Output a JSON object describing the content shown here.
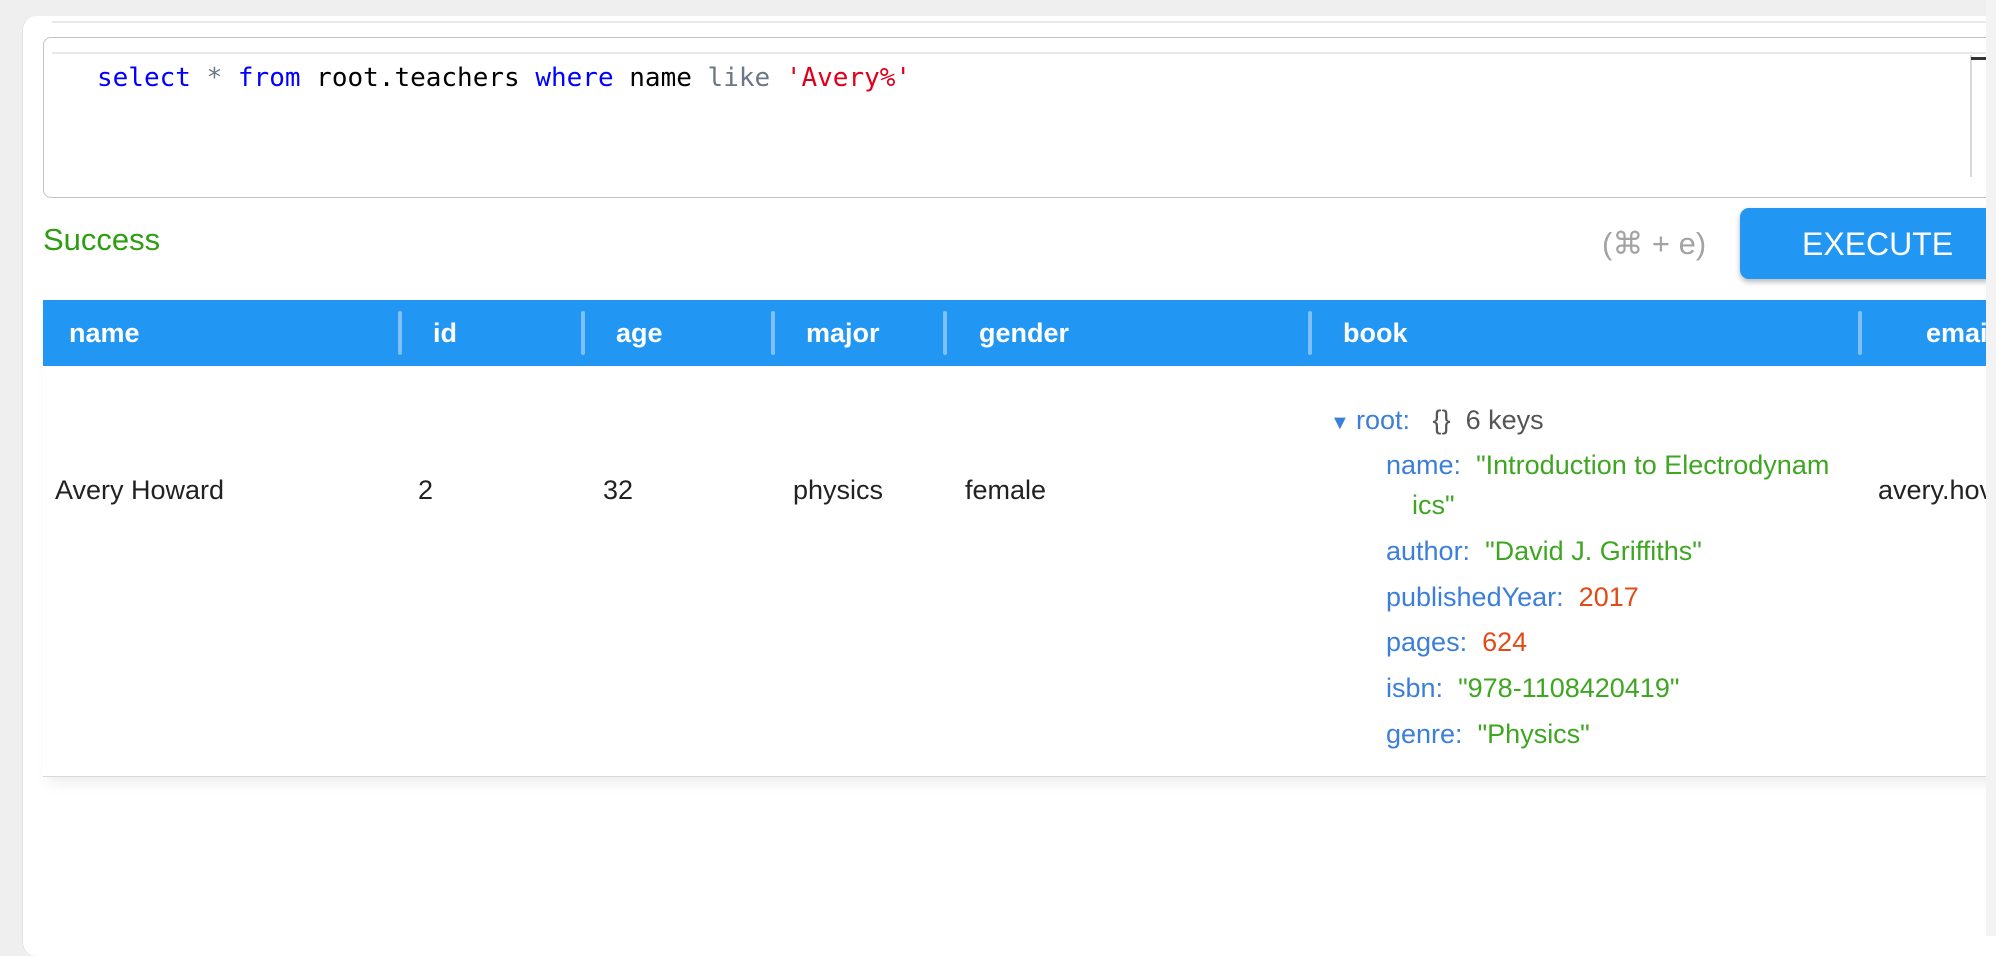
{
  "editor": {
    "query_tokens": {
      "kw_select": "select",
      "star": "*",
      "kw_from": "from",
      "table": "root.teachers",
      "kw_where": "where",
      "field": "name",
      "kw_like": "like",
      "pattern": "'Avery%'"
    }
  },
  "status": {
    "text": "Success",
    "color": "#2e9d12"
  },
  "shortcut": {
    "text": "(⌘ + e)"
  },
  "execute_button": {
    "label": "EXECUTE",
    "color": "#2196f3"
  },
  "table": {
    "header_color": "#2196f3",
    "columns": [
      "name",
      "id",
      "age",
      "major",
      "gender",
      "book",
      "email"
    ],
    "rows": [
      {
        "name": "Avery Howard",
        "id": "2",
        "age": "32",
        "major": "physics",
        "gender": "female",
        "email": "avery.hov",
        "book": {
          "root_key": "root:",
          "brace": "{}",
          "count": "6 keys",
          "entries": [
            {
              "key": "name:",
              "value_line1": "\"Introduction to Electrodynam",
              "value_line2": "ics\""
            },
            {
              "key": "author:",
              "value": "\"David J. Griffiths\""
            },
            {
              "key": "publishedYear:",
              "value": "2017"
            },
            {
              "key": "pages:",
              "value": "624"
            },
            {
              "key": "isbn:",
              "value": "\"978-1108420419\""
            },
            {
              "key": "genre:",
              "value": "\"Physics\""
            }
          ]
        }
      }
    ]
  },
  "icons": {
    "expand": "caret-down-icon"
  }
}
